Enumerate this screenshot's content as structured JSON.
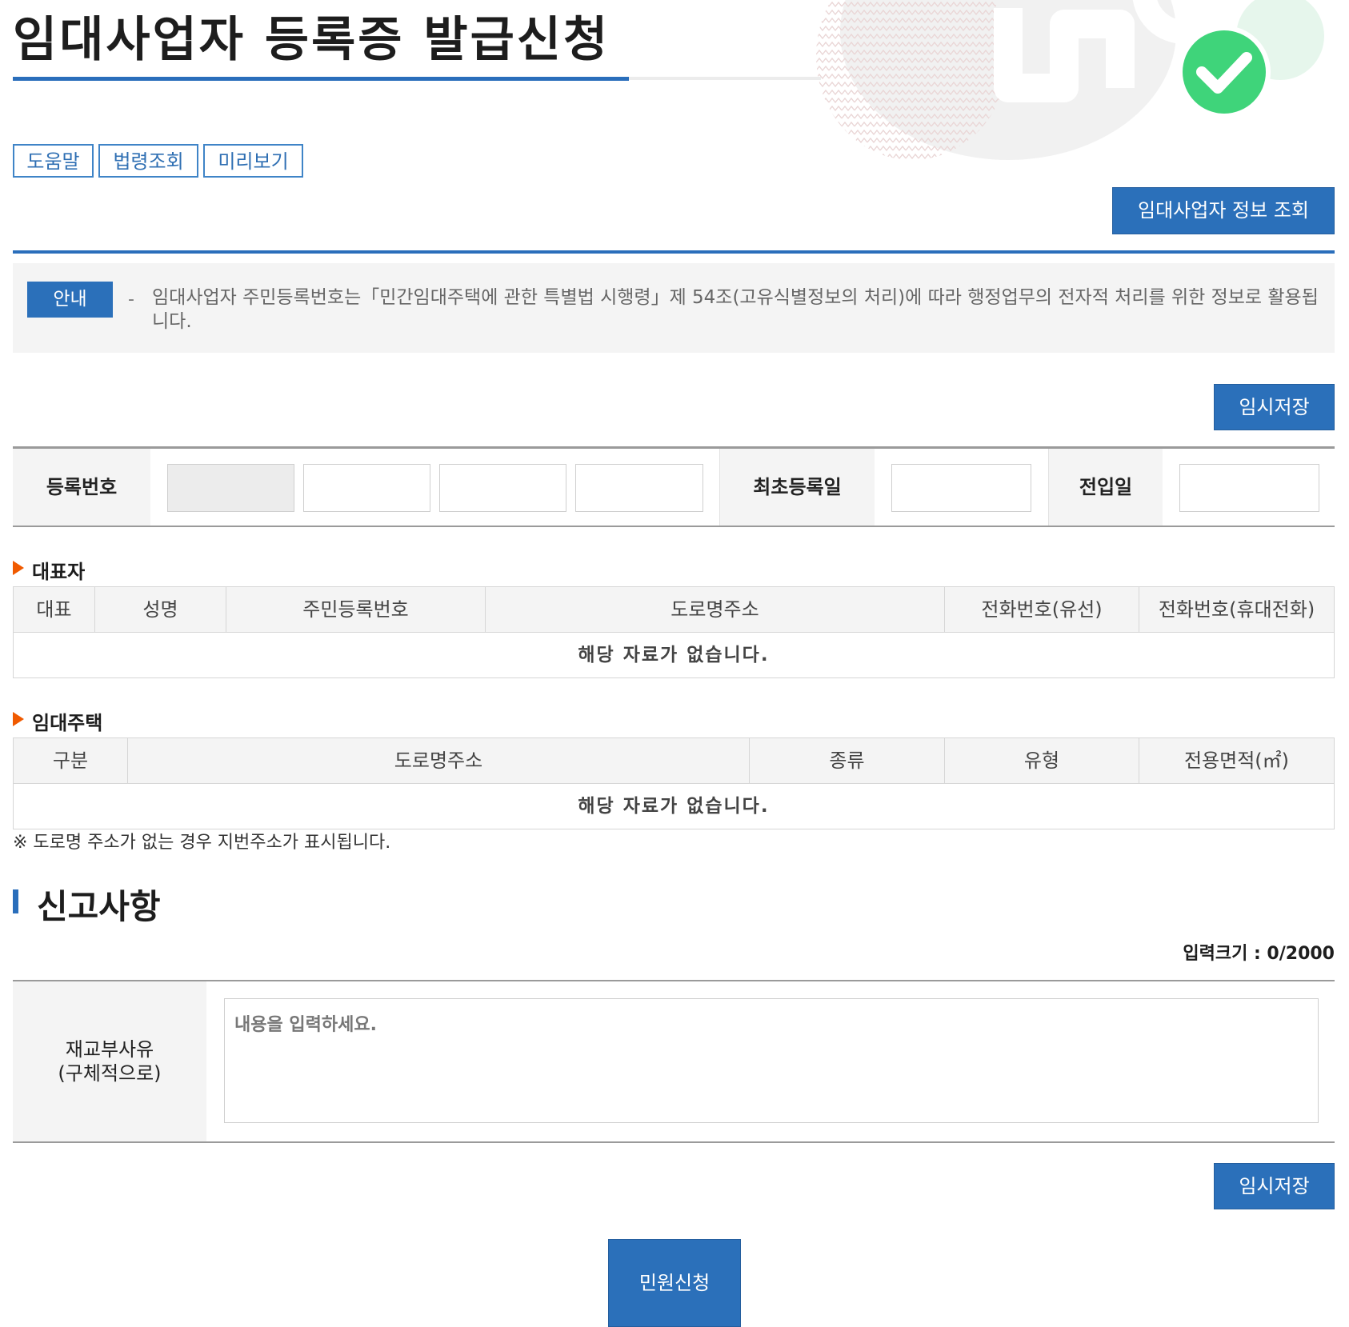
{
  "header": {
    "title": "임대사업자 등록증 발급신청"
  },
  "toolbar": {
    "help": "도움말",
    "law": "법령조회",
    "preview": "미리보기"
  },
  "lookup_button": "임대사업자 정보 조회",
  "notice": {
    "badge": "안내",
    "dash": "-",
    "text": "임대사업자 주민등록번호는「민간임대주택에 관한 특별법 시행령」제 54조(고유식별정보의 처리)에 따라 행정업무의 전자적 처리를 위한 정보로 활용됩니다."
  },
  "temp_save": "임시저장",
  "registration": {
    "reg_no_label": "등록번호",
    "first_reg_label": "최초등록일",
    "move_in_label": "전입일"
  },
  "representative": {
    "title": "대표자",
    "columns": [
      "대표",
      "성명",
      "주민등록번호",
      "도로명주소",
      "전화번호(유선)",
      "전화번호(휴대전화)"
    ],
    "empty": "해당 자료가 없습니다."
  },
  "housing": {
    "title": "임대주택",
    "columns": [
      "구분",
      "도로명주소",
      "종류",
      "유형",
      "전용면적(㎡)"
    ],
    "empty": "해당 자료가 없습니다.",
    "note": "※ 도로명 주소가 없는 경우 지번주소가 표시됩니다."
  },
  "report": {
    "title": "신고사항",
    "count_label": "입력크기 : 0/2000",
    "reason_label_1": "재교부사유",
    "reason_label_2": "(구체적으로)",
    "placeholder": "내용을 입력하세요."
  },
  "submit": "민원신청",
  "colors": {
    "accent": "#2b70ba",
    "marker": "#f05a00",
    "check": "#3fd47a"
  },
  "icons": {
    "decoration": "check-circle-icon",
    "section_marker": "triangle-right-icon"
  }
}
